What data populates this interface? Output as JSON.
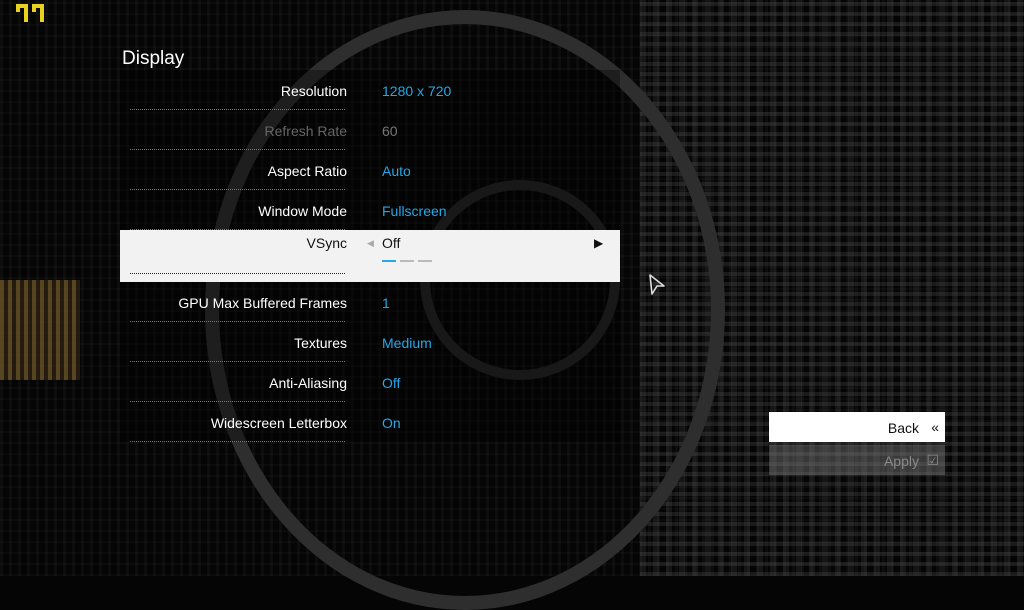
{
  "panel": {
    "title": "Display"
  },
  "settings": [
    {
      "label": "Resolution",
      "value": "1280 x 720"
    },
    {
      "label": "Refresh Rate",
      "value": "60",
      "disabled": true
    },
    {
      "label": "Aspect Ratio",
      "value": "Auto"
    },
    {
      "label": "Window Mode",
      "value": "Fullscreen"
    },
    {
      "label": "VSync",
      "value": "Off",
      "selected": true,
      "option_index": 0,
      "option_count": 3
    },
    {
      "label": "GPU Max Buffered Frames",
      "value": "1"
    },
    {
      "label": "Textures",
      "value": "Medium"
    },
    {
      "label": "Anti-Aliasing",
      "value": "Off"
    },
    {
      "label": "Widescreen Letterbox",
      "value": "On"
    }
  ],
  "buttons": {
    "back": {
      "label": "Back",
      "icon": "double-chevron-left-icon"
    },
    "apply": {
      "label": "Apply",
      "icon": "apply-checkbox-icon",
      "disabled": true
    }
  },
  "colors": {
    "value_accent": "#27a7e7",
    "selected_row_bg": "#f2f2f2",
    "logo": "#e8d21f"
  }
}
